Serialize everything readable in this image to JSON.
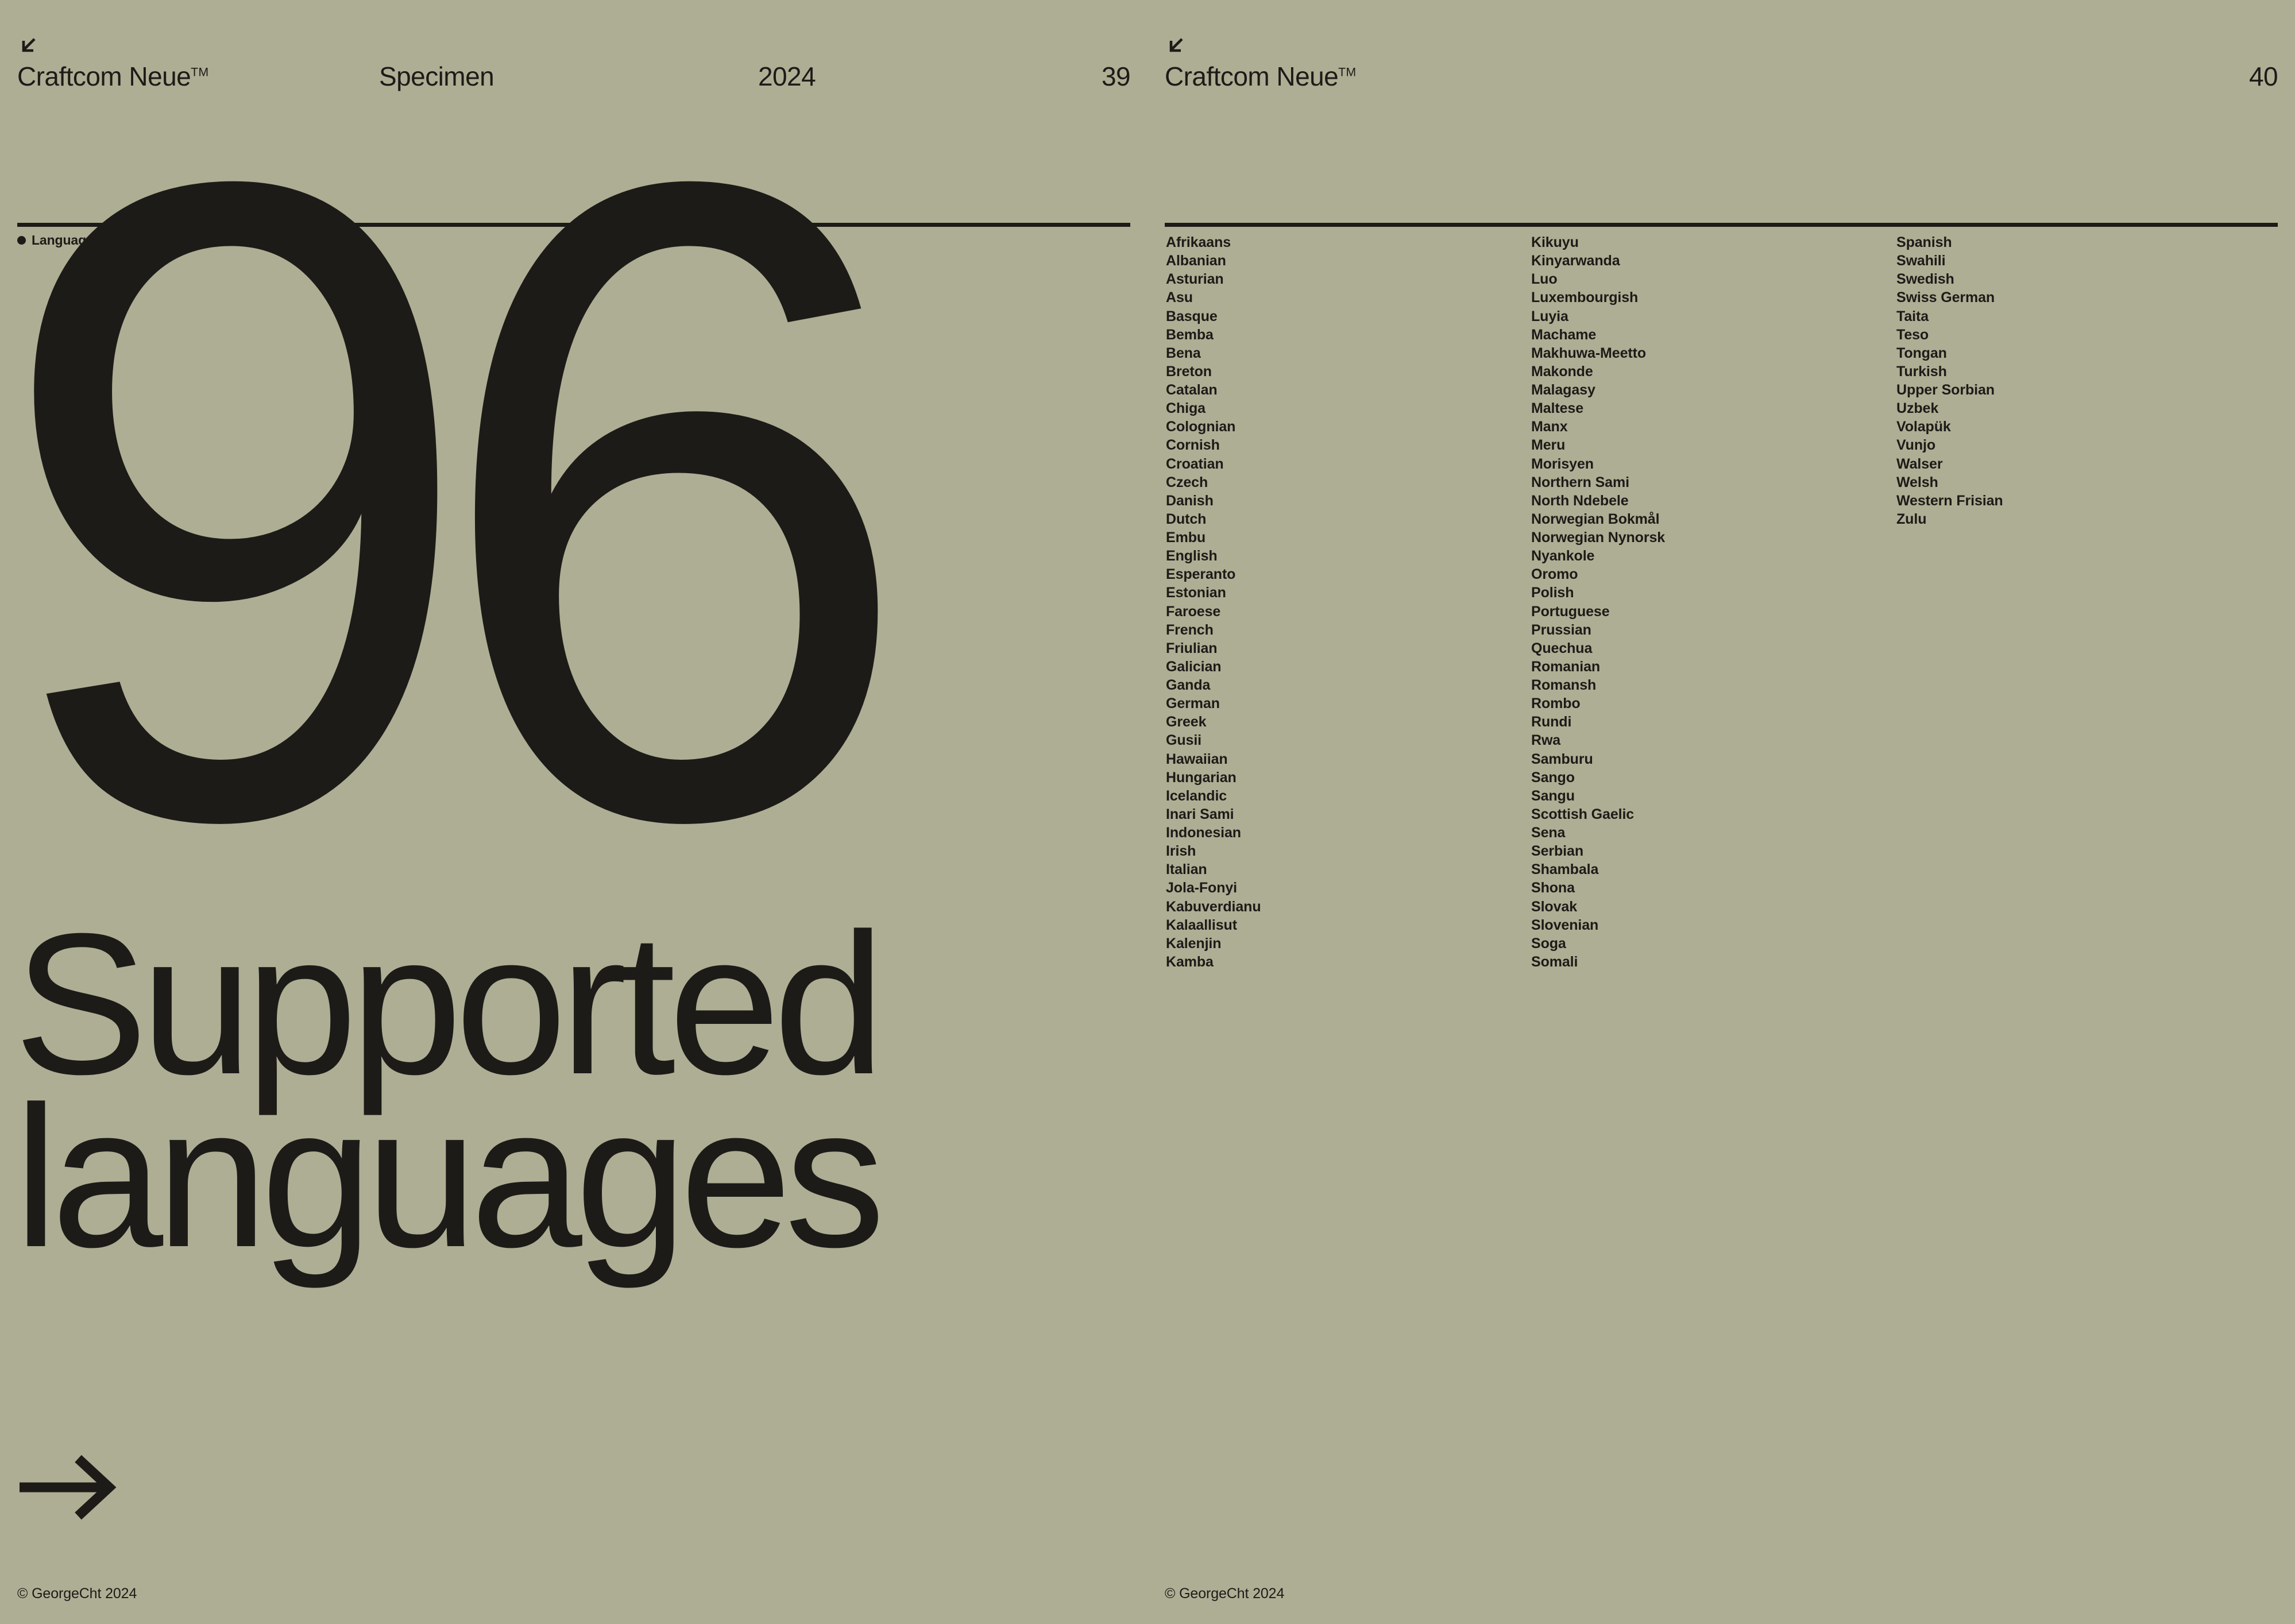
{
  "theme": {
    "background": "#aeae94",
    "ink": "#1d1b18"
  },
  "left_page": {
    "runhead": {
      "corner_marker": "arrow-down-left",
      "brand": "Craftcom Neue",
      "brand_mark": "TM",
      "section": "Specimen",
      "year": "2024",
      "folio": "39"
    },
    "section_label": "Language support",
    "big_number": "96",
    "headline_line1": "Supported",
    "headline_line2": "languages",
    "next_arrow": "arrow-right",
    "footer": "© GeorgeCht 2024"
  },
  "right_page": {
    "runhead": {
      "corner_marker": "arrow-down-left",
      "brand": "Craftcom Neue",
      "brand_mark": "TM",
      "folio": "40"
    },
    "footer": "© GeorgeCht 2024",
    "language_columns": [
      [
        "Afrikaans",
        "Albanian",
        "Asturian",
        "Asu",
        "Basque",
        "Bemba",
        "Bena",
        "Breton",
        "Catalan",
        "Chiga",
        "Colognian",
        "Cornish",
        "Croatian",
        "Czech",
        "Danish",
        "Dutch",
        "Embu",
        "English",
        "Esperanto",
        "Estonian",
        "Faroese",
        "French",
        "Friulian",
        "Galician",
        "Ganda",
        "German",
        "Greek",
        "Gusii",
        "Hawaiian",
        "Hungarian",
        "Icelandic",
        "Inari Sami",
        "Indonesian",
        "Irish",
        "Italian",
        "Jola-Fonyi",
        "Kabuverdianu",
        "Kalaallisut",
        "Kalenjin",
        "Kamba"
      ],
      [
        "Kikuyu",
        "Kinyarwanda",
        "Luo",
        "Luxembourgish",
        "Luyia",
        "Machame",
        "Makhuwa-Meetto",
        "Makonde",
        "Malagasy",
        "Maltese",
        "Manx",
        "Meru",
        "Morisyen",
        "Northern Sami",
        "North Ndebele",
        "Norwegian Bokmål",
        "Norwegian Nynorsk",
        "Nyankole",
        "Oromo",
        "Polish",
        "Portuguese",
        "Prussian",
        "Quechua",
        "Romanian",
        "Romansh",
        "Rombo",
        "Rundi",
        "Rwa",
        "Samburu",
        "Sango",
        "Sangu",
        "Scottish Gaelic",
        "Sena",
        "Serbian",
        "Shambala",
        "Shona",
        "Slovak",
        "Slovenian",
        "Soga",
        "Somali"
      ],
      [
        "Spanish",
        "Swahili",
        "Swedish",
        "Swiss German",
        "Taita",
        "Teso",
        "Tongan",
        "Turkish",
        "Upper Sorbian",
        "Uzbek",
        "Volapük",
        "Vunjo",
        "Walser",
        "Welsh",
        "Western Frisian",
        "Zulu"
      ]
    ]
  }
}
